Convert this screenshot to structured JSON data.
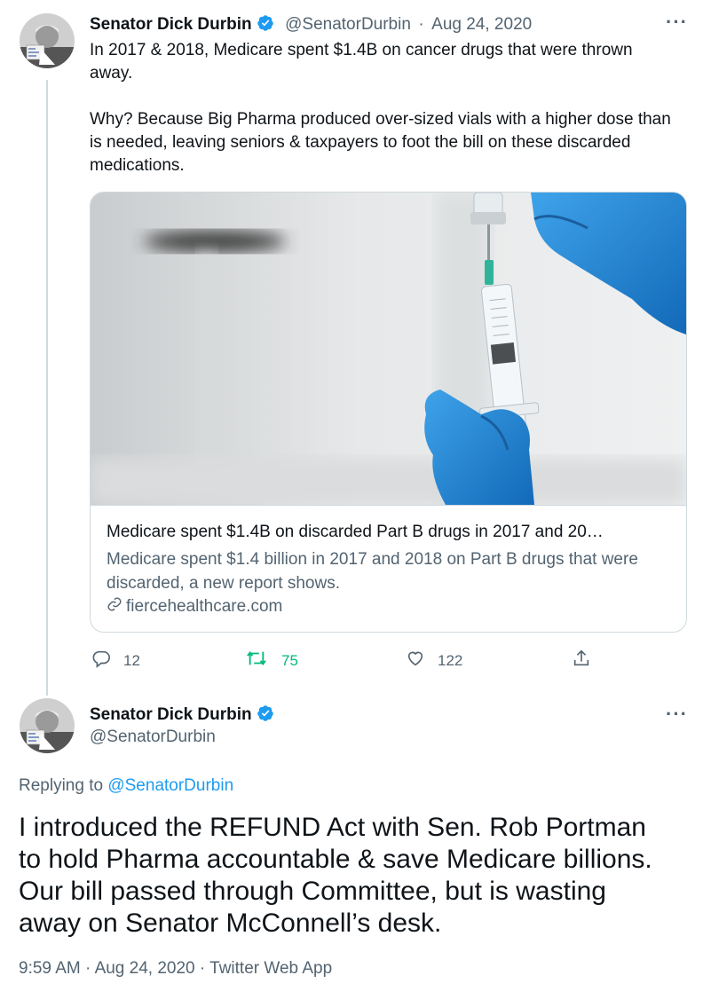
{
  "tweet1": {
    "author_name": "Senator Dick Durbin",
    "handle": "@SenatorDurbin",
    "separator": "·",
    "date": "Aug 24, 2020",
    "more_label": "···",
    "paragraphs": [
      "In 2017 & 2018, Medicare spent $1.4B on cancer drugs that were thrown away.",
      "Why? Because Big Pharma produced over-sized vials with a higher dose than is needed, leaving seniors & taxpayers to foot the bill on these discarded medications."
    ],
    "card": {
      "title": "Medicare spent $1.4B on discarded Part B drugs in 2017 and 20…",
      "description": "Medicare spent $1.4 billion in 2017 and 2018 on Part B drugs that were discarded, a new report shows.",
      "domain": "fiercehealthcare.com",
      "link_icon": "link-icon"
    },
    "actions": {
      "replies": "12",
      "retweets": "75",
      "likes": "122"
    },
    "colors": {
      "retweet": "#00ba7c",
      "verified": "#1d9bf0"
    }
  },
  "tweet2": {
    "author_name": "Senator Dick Durbin",
    "handle": "@SenatorDurbin",
    "more_label": "···",
    "replying_prefix": "Replying to",
    "replying_handle": "@SenatorDurbin",
    "lines": [
      "I introduced the REFUND Act with Sen. Rob Portman",
      "to hold Pharma accountable & save Medicare billions.",
      "Our bill passed through Committee, but is wasting",
      "away on Senator McConnell’s desk."
    ],
    "time": "9:59 AM",
    "date": "Aug 24, 2020",
    "source": "Twitter Web App",
    "separator": "·"
  },
  "colors": {
    "link": "#1d9bf0",
    "secondary_text": "#536471",
    "border": "#cfd9de"
  }
}
